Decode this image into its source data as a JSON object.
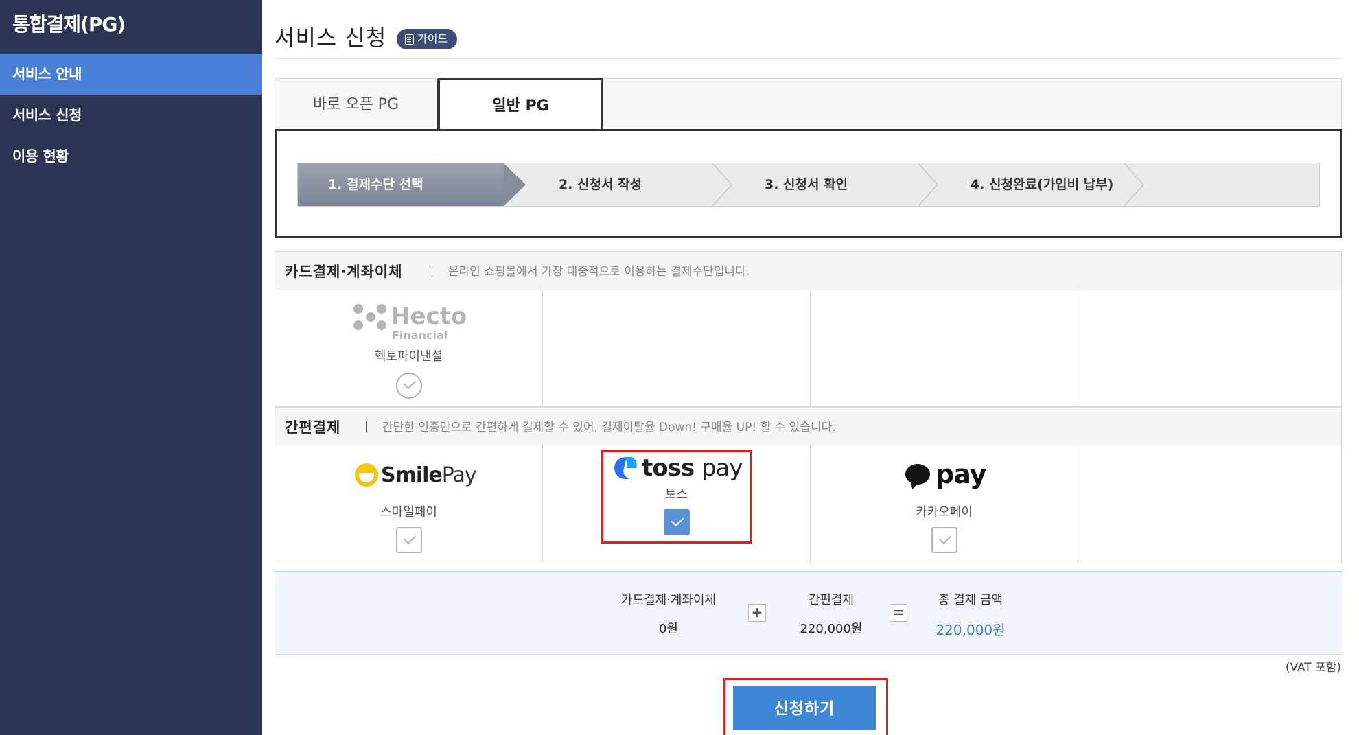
{
  "sidebar": {
    "title": "통합결제(PG)",
    "items": [
      {
        "label": "서비스 안내",
        "active": true
      },
      {
        "label": "서비스 신청",
        "active": false
      },
      {
        "label": "이용 현황",
        "active": false
      }
    ]
  },
  "header": {
    "title": "서비스 신청",
    "guide_label": "가이드"
  },
  "tabs": [
    {
      "label": "바로 오픈 PG",
      "active": false
    },
    {
      "label": "일반 PG",
      "active": true
    }
  ],
  "steps": [
    {
      "label": "1. 결제수단 선택",
      "active": true
    },
    {
      "label": "2. 신청서 작성",
      "active": false
    },
    {
      "label": "3. 신청서 확인",
      "active": false
    },
    {
      "label": "4. 신청완료(가입비 납부)",
      "active": false
    }
  ],
  "sections": {
    "card": {
      "title": "카드결제·계좌이체",
      "description": "온라인 쇼핑몰에서 가장 대중적으로 이용하는 결제수단입니다.",
      "providers": [
        {
          "logo_main": "Hecto",
          "logo_sub": "Financial",
          "name": "헥토파이낸셜",
          "checked": false
        }
      ]
    },
    "easy": {
      "title": "간편결제",
      "description": "간단한 인증만으로 간편하게 결제할 수 있어, 결제이탈율 Down! 구매율 UP! 할 수 있습니다.",
      "providers": [
        {
          "logo_bold": "Smile",
          "logo_light": "Pay",
          "name": "스마일페이",
          "checked": false
        },
        {
          "logo_bold": "toss",
          "logo_light": "pay",
          "name": "토스",
          "checked": true
        },
        {
          "logo_text": "pay",
          "name": "카카오페이",
          "checked": false
        }
      ]
    }
  },
  "summary": {
    "card_label": "카드결제·계좌이체",
    "card_value": "0원",
    "plus": "+",
    "easy_label": "간편결제",
    "easy_value": "220,000원",
    "equals": "=",
    "total_label": "총 결제 금액",
    "total_value": "220,000원",
    "vat_note": "(VAT 포함)"
  },
  "apply_button": "신청하기",
  "colors": {
    "sidebar_bg": "#2b3553",
    "accent": "#4a7fd8",
    "highlight": "#e02020",
    "checked": "#5b8fd6"
  }
}
